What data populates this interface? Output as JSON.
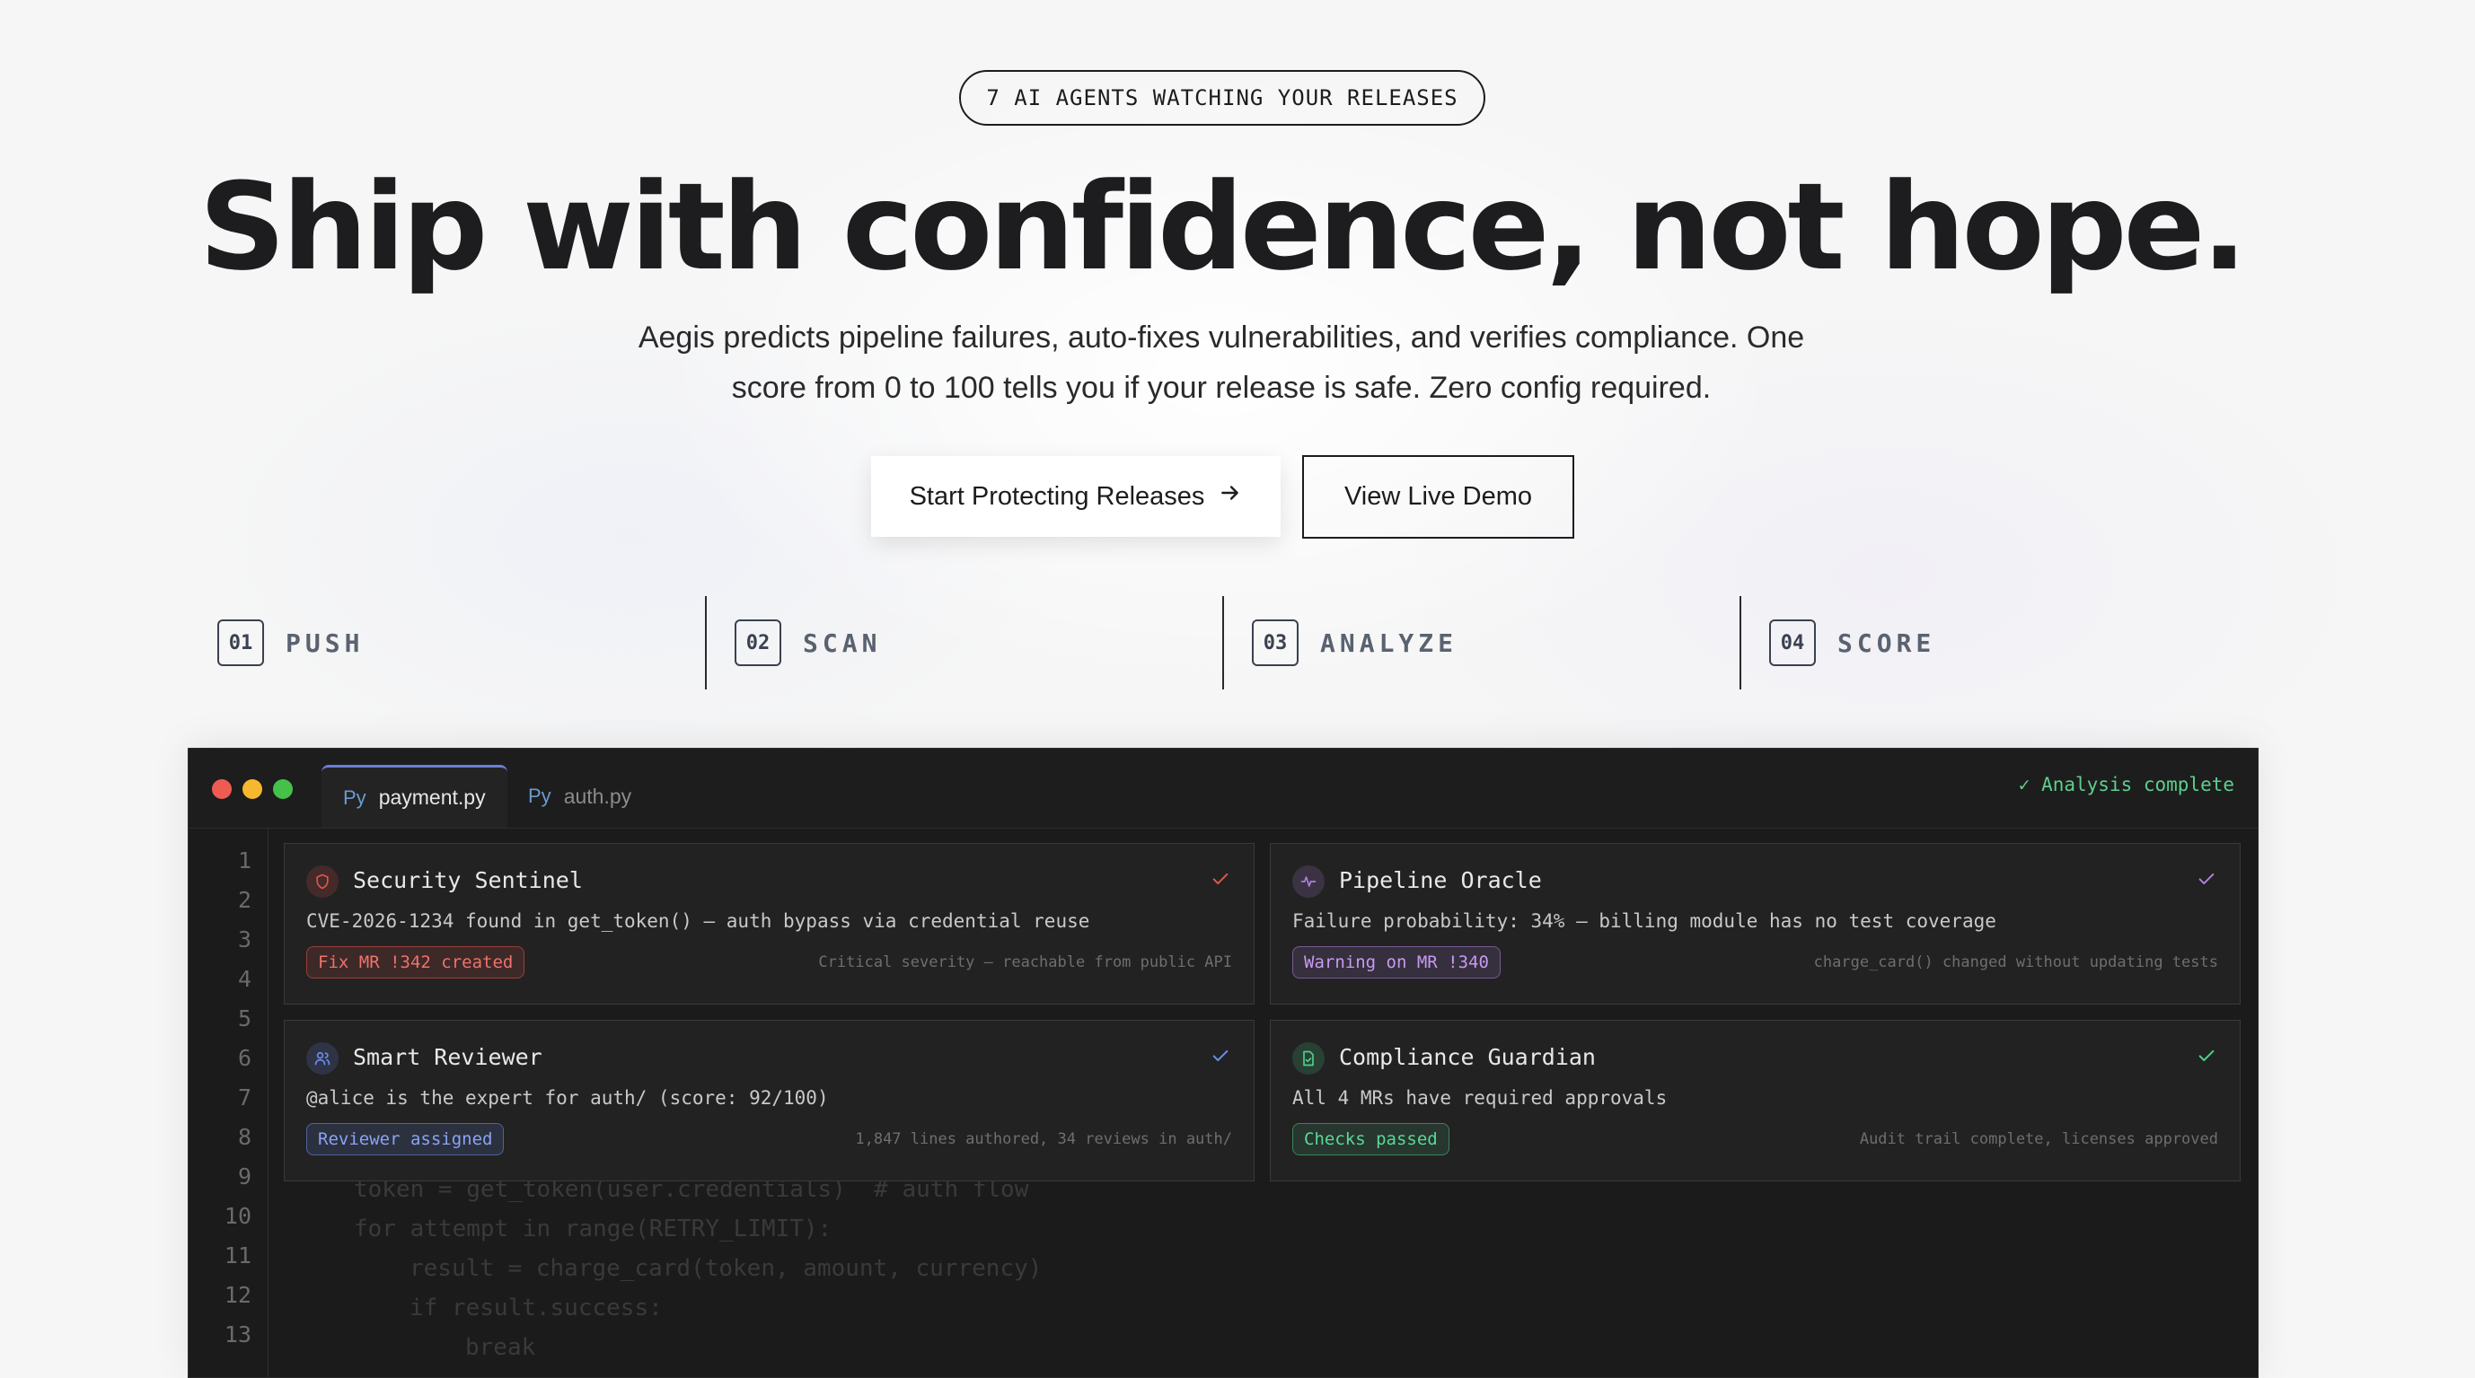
{
  "hero": {
    "pill": "7 AI AGENTS WATCHING YOUR RELEASES",
    "title": "Ship with confidence, not hope.",
    "subtitle_line1": "Aegis predicts pipeline failures, auto-fixes vulnerabilities, and verifies compliance. One",
    "subtitle_line2": "score from 0 to 100 tells you if your release is safe. Zero config required.",
    "primary_cta": "Start Protecting Releases",
    "primary_cta_icon": "arrow-right-icon",
    "secondary_cta": "View Live Demo"
  },
  "steps": [
    {
      "num": "01",
      "label": "PUSH"
    },
    {
      "num": "02",
      "label": "SCAN"
    },
    {
      "num": "03",
      "label": "ANALYZE"
    },
    {
      "num": "04",
      "label": "SCORE"
    }
  ],
  "editor": {
    "tabs": [
      {
        "icon": "Py",
        "label": "payment.py",
        "active": true
      },
      {
        "icon": "Py",
        "label": "auth.py",
        "active": false
      }
    ],
    "status": "✓ Analysis complete",
    "line_numbers": [
      "1",
      "2",
      "3",
      "4",
      "5",
      "6",
      "7",
      "8",
      "9",
      "10",
      "11",
      "12",
      "13"
    ],
    "visible_code": {
      "line9": "token = get_token(user.credentials)  # auth flow",
      "line10": "for attempt in range(RETRY_LIMIT):",
      "line11": "result = charge_card(token, amount, currency)",
      "line12": "if result.success:",
      "line13": "break"
    },
    "cards": [
      {
        "title": "Security Sentinel",
        "icon": "shield-icon",
        "accent": "#e5534b",
        "desc": "CVE-2026-1234 found in get_token() — auth bypass via credential reuse",
        "badge": "Fix MR !342 created",
        "note": "Critical severity — reachable from public API"
      },
      {
        "title": "Pipeline Oracle",
        "icon": "activity-icon",
        "accent": "#b07ee0",
        "desc": "Failure probability: 34% — billing module has no test coverage",
        "badge": "Warning on MR !340",
        "note": "charge_card() changed without updating tests"
      },
      {
        "title": "Smart Reviewer",
        "icon": "users-icon",
        "accent": "#6b8cf0",
        "desc": "@alice is the expert for auth/ (score: 92/100)",
        "badge": "Reviewer assigned",
        "note": "1,847 lines authored, 34 reviews in auth/"
      },
      {
        "title": "Compliance Guardian",
        "icon": "document-check-icon",
        "accent": "#4fcf8a",
        "desc": "All 4 MRs have required approvals",
        "badge": "Checks passed",
        "note": "Audit trail complete, licenses approved"
      }
    ]
  },
  "colors": {
    "background": "#f6f6f6",
    "editor_bg": "#1b1b1b",
    "success": "#5ccf8c"
  }
}
